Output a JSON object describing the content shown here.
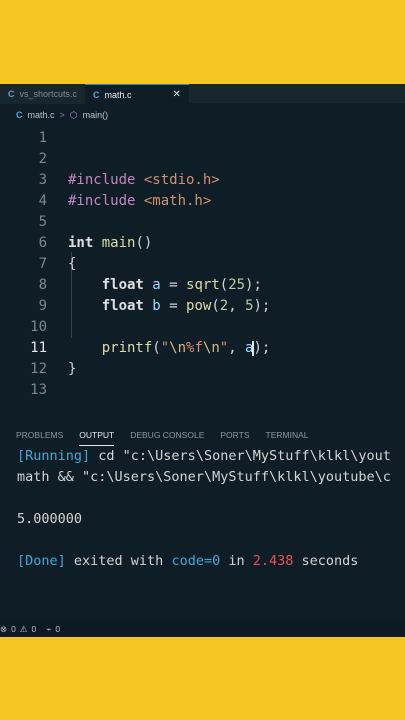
{
  "tabs": [
    {
      "label": "vs_shortcuts.c",
      "icon": "c-file-icon",
      "active": false
    },
    {
      "label": "math.c",
      "icon": "c-file-icon",
      "active": true,
      "close": "✕"
    }
  ],
  "breadcrumb": {
    "file": "math.c",
    "sep": ">",
    "symbol": "main()"
  },
  "editor": {
    "line_numbers": [
      "1",
      "2",
      "3",
      "4",
      "5",
      "6",
      "7",
      "8",
      "9",
      "10",
      "11",
      "12",
      "13"
    ],
    "lines": [
      [],
      [],
      [
        [
          "kw-pre",
          "#include "
        ],
        [
          "inc",
          "<stdio.h>"
        ]
      ],
      [
        [
          "kw-pre",
          "#include "
        ],
        [
          "inc",
          "<math.h>"
        ]
      ],
      [],
      [
        [
          "type",
          "int "
        ],
        [
          "fn",
          "main"
        ],
        [
          "plain",
          "()"
        ]
      ],
      [
        [
          "plain",
          "{"
        ]
      ],
      [
        [
          "plain",
          "    "
        ],
        [
          "type",
          "float "
        ],
        [
          "var",
          "a"
        ],
        [
          "plain",
          " = "
        ],
        [
          "fn",
          "sqrt"
        ],
        [
          "plain",
          "("
        ],
        [
          "num",
          "25"
        ],
        [
          "plain",
          ");"
        ]
      ],
      [
        [
          "plain",
          "    "
        ],
        [
          "type",
          "float "
        ],
        [
          "var",
          "b"
        ],
        [
          "plain",
          " = "
        ],
        [
          "fn",
          "pow"
        ],
        [
          "plain",
          "("
        ],
        [
          "num",
          "2"
        ],
        [
          "plain",
          ", "
        ],
        [
          "num",
          "5"
        ],
        [
          "plain",
          ");"
        ]
      ],
      [],
      [
        [
          "plain",
          "    "
        ],
        [
          "fn",
          "printf"
        ],
        [
          "plain",
          "("
        ],
        [
          "str",
          "\""
        ],
        [
          "esc",
          "\\n"
        ],
        [
          "str",
          "%f"
        ],
        [
          "esc",
          "\\n"
        ],
        [
          "str",
          "\""
        ],
        [
          "plain",
          ", "
        ],
        [
          "var",
          "a"
        ],
        [
          "cursor",
          ""
        ],
        [
          "plain",
          ");"
        ]
      ],
      [
        [
          "plain",
          "}"
        ]
      ],
      []
    ]
  },
  "panel": {
    "tabs": [
      "PROBLEMS",
      "OUTPUT",
      "DEBUG CONSOLE",
      "PORTS",
      "TERMINAL"
    ],
    "active_tab": "OUTPUT",
    "output": [
      [
        [
          "cyan",
          "[Running] "
        ],
        [
          "plain",
          "cd \"c:\\Users\\Soner\\MyStuff\\klkl\\yout"
        ]
      ],
      [
        [
          "plain",
          "math && \"c:\\Users\\Soner\\MyStuff\\klkl\\youtube\\c"
        ]
      ],
      [],
      [
        [
          "plain",
          "5.000000"
        ]
      ],
      [],
      [
        [
          "cyan",
          "[Done] "
        ],
        [
          "plain",
          "exited with "
        ],
        [
          "cyan",
          "code=0"
        ],
        [
          "plain",
          " in "
        ],
        [
          "red",
          "2.438"
        ],
        [
          "plain",
          " seconds"
        ]
      ]
    ]
  },
  "status": {
    "errors": "0",
    "warnings": "0",
    "ports": "0"
  },
  "colors": {
    "background": "#f6c623",
    "editor_bg": "#0f1e26",
    "accent": "#2b82c8"
  }
}
